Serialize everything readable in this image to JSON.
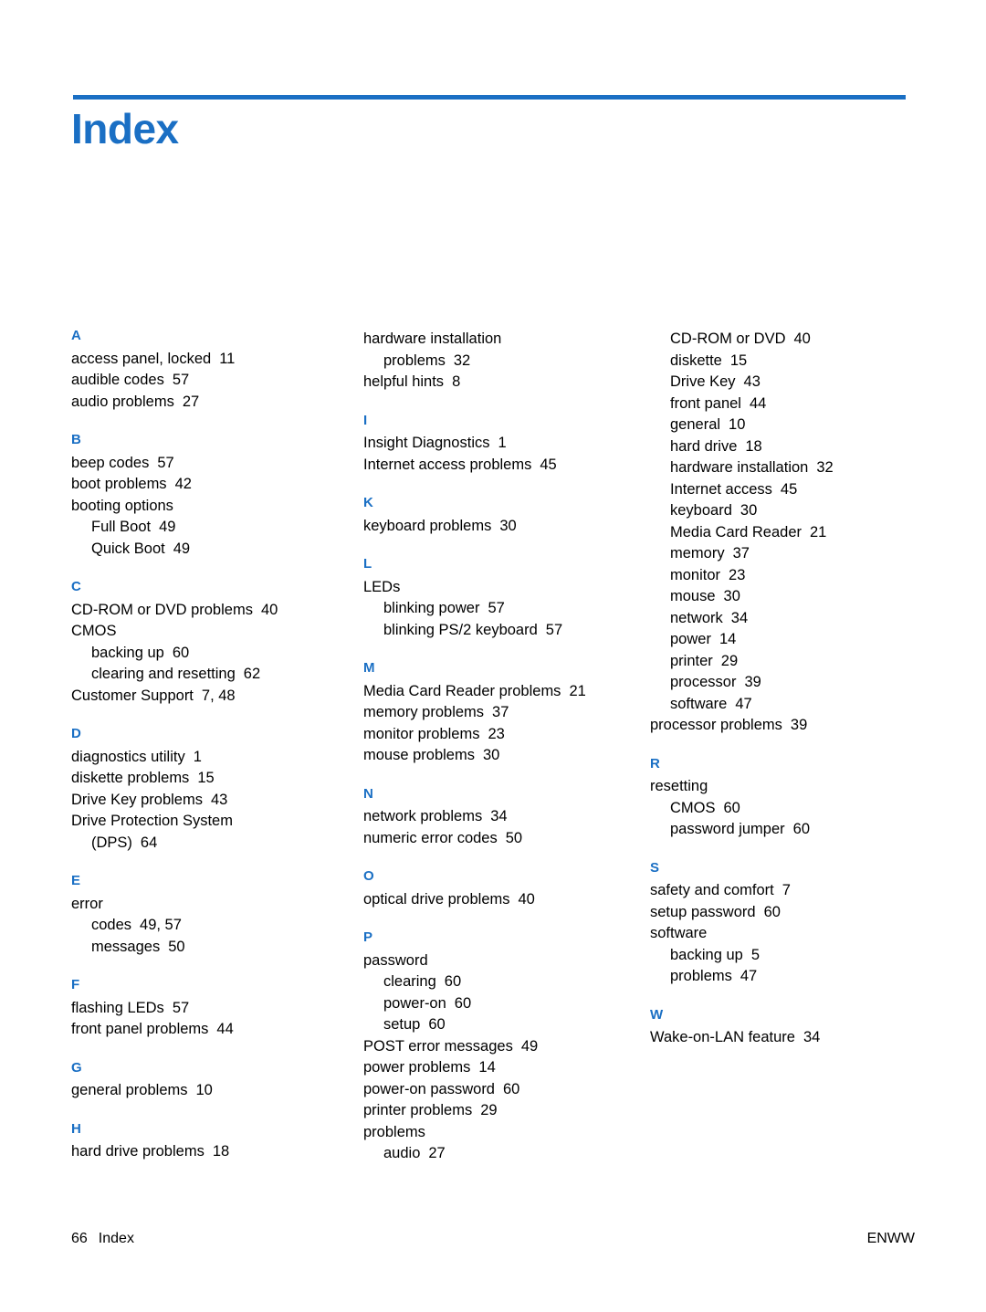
{
  "document": {
    "title": "Index",
    "footer_page": "66",
    "footer_label": "Index",
    "footer_right": "ENWW",
    "accent_color": "#1a6fc4"
  },
  "columns": [
    {
      "groups": [
        {
          "letter": "A",
          "entries": [
            {
              "text": "access panel, locked",
              "page": "11",
              "sub": false
            },
            {
              "text": "audible codes",
              "page": "57",
              "sub": false
            },
            {
              "text": "audio problems",
              "page": "27",
              "sub": false
            }
          ]
        },
        {
          "letter": "B",
          "entries": [
            {
              "text": "beep codes",
              "page": "57",
              "sub": false
            },
            {
              "text": "boot problems",
              "page": "42",
              "sub": false
            },
            {
              "text": "booting options",
              "page": "",
              "sub": false
            },
            {
              "text": "Full Boot",
              "page": "49",
              "sub": true
            },
            {
              "text": "Quick Boot",
              "page": "49",
              "sub": true
            }
          ]
        },
        {
          "letter": "C",
          "entries": [
            {
              "text": "CD-ROM or DVD problems",
              "page": "40",
              "sub": false
            },
            {
              "text": "CMOS",
              "page": "",
              "sub": false
            },
            {
              "text": "backing up",
              "page": "60",
              "sub": true
            },
            {
              "text": "clearing and resetting",
              "page": "62",
              "sub": true
            },
            {
              "text": "Customer Support",
              "page": "7,  48",
              "sub": false
            }
          ]
        },
        {
          "letter": "D",
          "entries": [
            {
              "text": "diagnostics utility",
              "page": "1",
              "sub": false
            },
            {
              "text": "diskette problems",
              "page": "15",
              "sub": false
            },
            {
              "text": "Drive Key problems",
              "page": "43",
              "sub": false
            },
            {
              "text": "Drive Protection System",
              "page": "",
              "sub": false
            },
            {
              "text": "(DPS)",
              "page": "64",
              "sub": true
            }
          ]
        },
        {
          "letter": "E",
          "entries": [
            {
              "text": "error",
              "page": "",
              "sub": false
            },
            {
              "text": "codes",
              "page": "49,  57",
              "sub": true
            },
            {
              "text": "messages",
              "page": "50",
              "sub": true
            }
          ]
        },
        {
          "letter": "F",
          "entries": [
            {
              "text": "flashing LEDs",
              "page": "57",
              "sub": false
            },
            {
              "text": "front panel problems",
              "page": "44",
              "sub": false
            }
          ]
        },
        {
          "letter": "G",
          "entries": [
            {
              "text": "general problems",
              "page": "10",
              "sub": false
            }
          ]
        },
        {
          "letter": "H",
          "entries": [
            {
              "text": "hard drive problems",
              "page": "18",
              "sub": false
            }
          ]
        }
      ]
    },
    {
      "groups": [
        {
          "letter": "",
          "entries": [
            {
              "text": "hardware installation",
              "page": "",
              "sub": false
            },
            {
              "text": "problems",
              "page": "32",
              "sub": true
            },
            {
              "text": "helpful hints",
              "page": "8",
              "sub": false
            }
          ]
        },
        {
          "letter": "I",
          "entries": [
            {
              "text": "Insight Diagnostics",
              "page": "1",
              "sub": false
            },
            {
              "text": "Internet access problems",
              "page": "45",
              "sub": false
            }
          ]
        },
        {
          "letter": "K",
          "entries": [
            {
              "text": "keyboard problems",
              "page": "30",
              "sub": false
            }
          ]
        },
        {
          "letter": "L",
          "entries": [
            {
              "text": "LEDs",
              "page": "",
              "sub": false
            },
            {
              "text": "blinking power",
              "page": "57",
              "sub": true
            },
            {
              "text": "blinking PS/2 keyboard",
              "page": "57",
              "sub": true
            }
          ]
        },
        {
          "letter": "M",
          "entries": [
            {
              "text": "Media Card Reader problems",
              "page": "21",
              "sub": false
            },
            {
              "text": "memory problems",
              "page": "37",
              "sub": false
            },
            {
              "text": "monitor problems",
              "page": "23",
              "sub": false
            },
            {
              "text": "mouse problems",
              "page": "30",
              "sub": false
            }
          ]
        },
        {
          "letter": "N",
          "entries": [
            {
              "text": "network problems",
              "page": "34",
              "sub": false
            },
            {
              "text": "numeric error codes",
              "page": "50",
              "sub": false
            }
          ]
        },
        {
          "letter": "O",
          "entries": [
            {
              "text": "optical drive problems",
              "page": "40",
              "sub": false
            }
          ]
        },
        {
          "letter": "P",
          "entries": [
            {
              "text": "password",
              "page": "",
              "sub": false
            },
            {
              "text": "clearing",
              "page": "60",
              "sub": true
            },
            {
              "text": "power-on",
              "page": "60",
              "sub": true
            },
            {
              "text": "setup",
              "page": "60",
              "sub": true
            },
            {
              "text": "POST error messages",
              "page": "49",
              "sub": false
            },
            {
              "text": "power problems",
              "page": "14",
              "sub": false
            },
            {
              "text": "power-on password",
              "page": "60",
              "sub": false
            },
            {
              "text": "printer problems",
              "page": "29",
              "sub": false
            },
            {
              "text": "problems",
              "page": "",
              "sub": false
            },
            {
              "text": "audio",
              "page": "27",
              "sub": true
            }
          ]
        }
      ]
    },
    {
      "groups": [
        {
          "letter": "",
          "entries": [
            {
              "text": "CD-ROM or DVD",
              "page": "40",
              "sub": true
            },
            {
              "text": "diskette",
              "page": "15",
              "sub": true
            },
            {
              "text": "Drive Key",
              "page": "43",
              "sub": true
            },
            {
              "text": "front panel",
              "page": "44",
              "sub": true
            },
            {
              "text": "general",
              "page": "10",
              "sub": true
            },
            {
              "text": "hard drive",
              "page": "18",
              "sub": true
            },
            {
              "text": "hardware installation",
              "page": "32",
              "sub": true
            },
            {
              "text": "Internet access",
              "page": "45",
              "sub": true
            },
            {
              "text": "keyboard",
              "page": "30",
              "sub": true
            },
            {
              "text": "Media Card Reader",
              "page": "21",
              "sub": true
            },
            {
              "text": "memory",
              "page": "37",
              "sub": true
            },
            {
              "text": "monitor",
              "page": "23",
              "sub": true
            },
            {
              "text": "mouse",
              "page": "30",
              "sub": true
            },
            {
              "text": "network",
              "page": "34",
              "sub": true
            },
            {
              "text": "power",
              "page": "14",
              "sub": true
            },
            {
              "text": "printer",
              "page": "29",
              "sub": true
            },
            {
              "text": "processor",
              "page": "39",
              "sub": true
            },
            {
              "text": "software",
              "page": "47",
              "sub": true
            },
            {
              "text": "processor problems",
              "page": "39",
              "sub": false
            }
          ]
        },
        {
          "letter": "R",
          "entries": [
            {
              "text": "resetting",
              "page": "",
              "sub": false
            },
            {
              "text": "CMOS",
              "page": "60",
              "sub": true
            },
            {
              "text": "password jumper",
              "page": "60",
              "sub": true
            }
          ]
        },
        {
          "letter": "S",
          "entries": [
            {
              "text": "safety and comfort",
              "page": "7",
              "sub": false
            },
            {
              "text": "setup password",
              "page": "60",
              "sub": false
            },
            {
              "text": "software",
              "page": "",
              "sub": false
            },
            {
              "text": "backing up",
              "page": "5",
              "sub": true
            },
            {
              "text": "problems",
              "page": "47",
              "sub": true
            }
          ]
        },
        {
          "letter": "W",
          "entries": [
            {
              "text": "Wake-on-LAN feature",
              "page": "34",
              "sub": false
            }
          ]
        }
      ]
    }
  ]
}
